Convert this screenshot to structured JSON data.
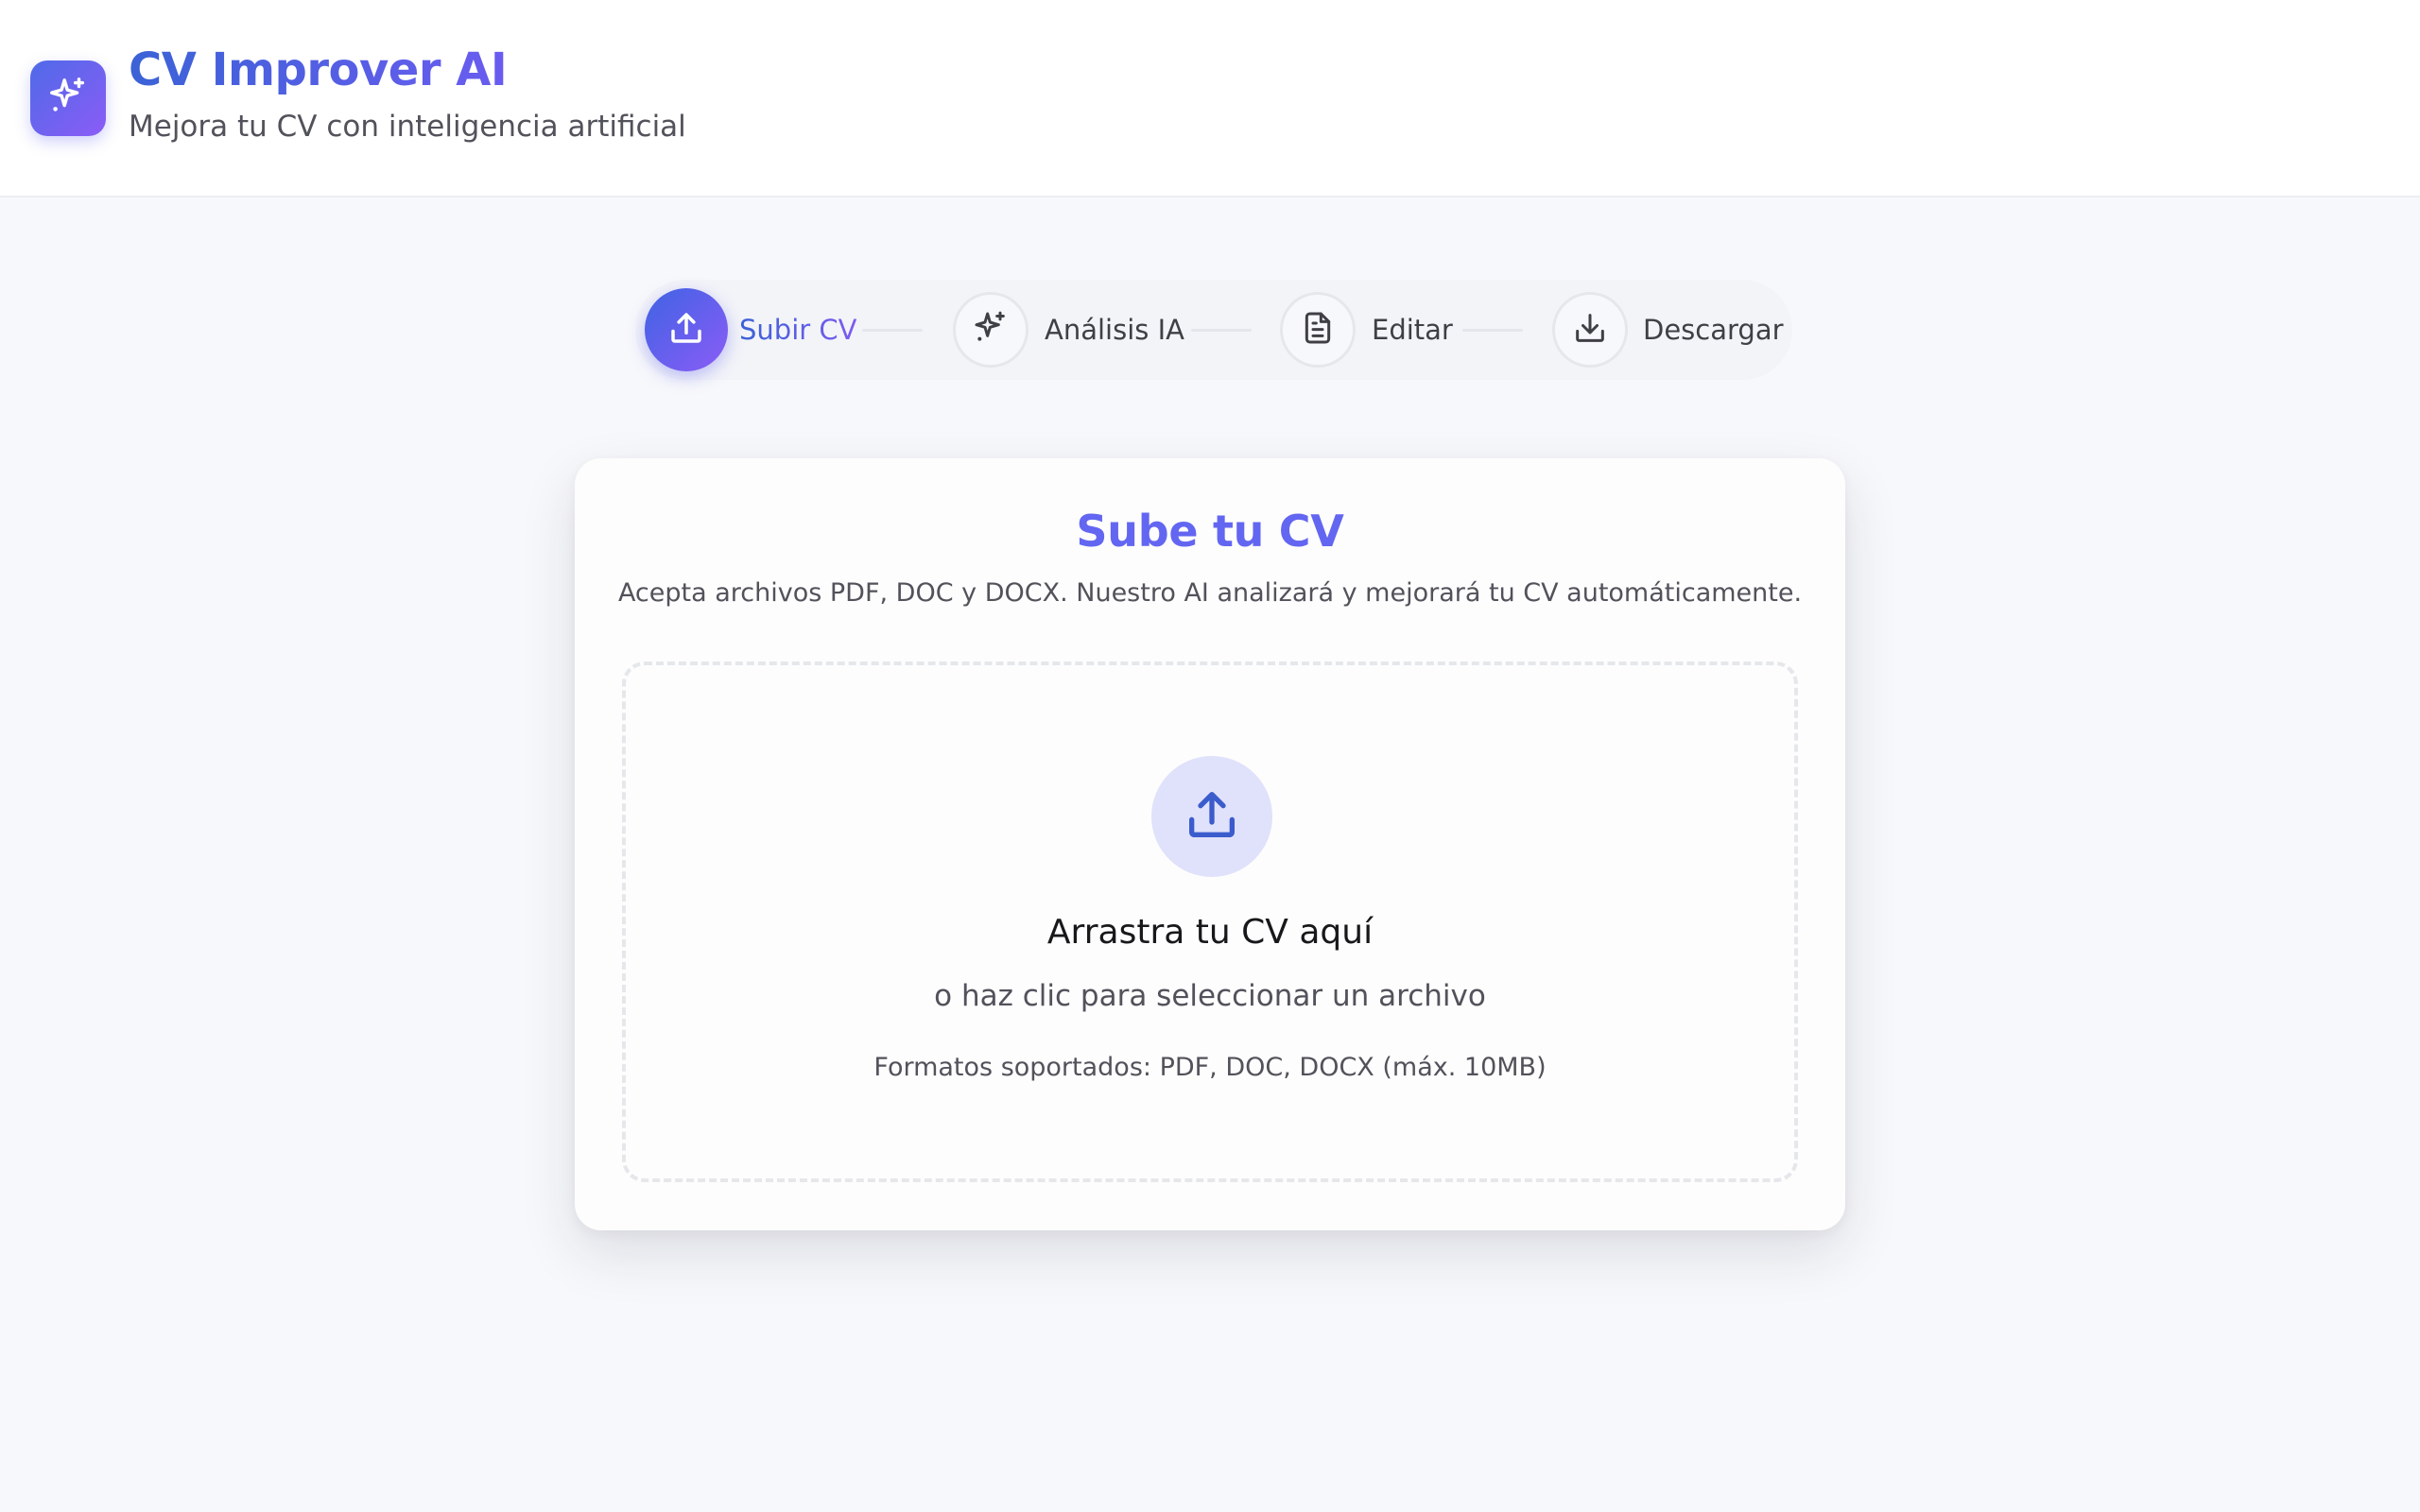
{
  "header": {
    "title": "CV Improver AI",
    "subtitle": "Mejora tu CV con inteligencia artificial",
    "logo_icon": "sparkles-icon"
  },
  "stepper": {
    "steps": [
      {
        "label": "Subir CV",
        "icon": "upload-icon",
        "active": true
      },
      {
        "label": "Análisis IA",
        "icon": "sparkles-icon",
        "active": false
      },
      {
        "label": "Editar",
        "icon": "document-icon",
        "active": false
      },
      {
        "label": "Descargar",
        "icon": "download-icon",
        "active": false
      }
    ]
  },
  "upload_card": {
    "title": "Sube tu CV",
    "description": "Acepta archivos PDF, DOC y DOCX. Nuestro AI analizará y mejorará tu CV automáticamente.",
    "dropzone": {
      "icon": "upload-icon",
      "title": "Arrastra tu CV aquí",
      "subtitle": "o haz clic para seleccionar un archivo",
      "formats": "Formatos soportados: PDF, DOC, DOCX (máx. 10MB)"
    }
  },
  "colors": {
    "brand_primary": "#6366f1",
    "brand_blue": "#3b62d6",
    "brand_purple": "#8b5cf6",
    "background": "#f7f8fb"
  }
}
